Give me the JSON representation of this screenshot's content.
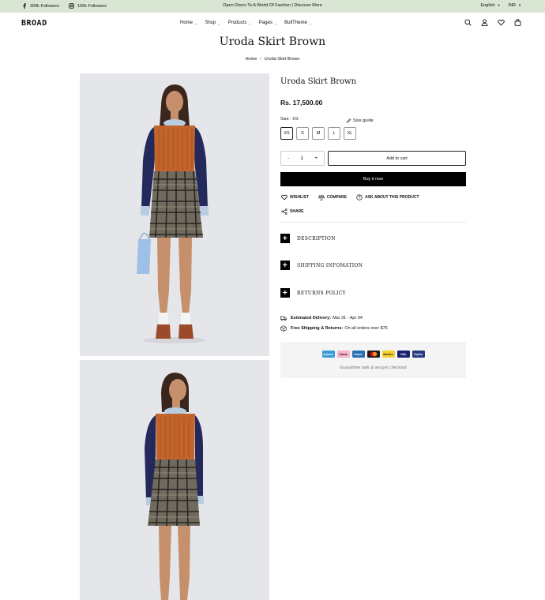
{
  "topbar": {
    "facebook_followers": "300k Followers",
    "instagram_followers": "100k Followers",
    "announcement": "Open Doors To A World Of Fashion | Discover More",
    "language": "English",
    "currency": "INR"
  },
  "header": {
    "logo": "BROAD",
    "nav": [
      "Home",
      "Shop",
      "Products",
      "Pages",
      "BullTheme"
    ],
    "icons": [
      "search-icon",
      "user-icon",
      "heart-icon",
      "bag-icon"
    ]
  },
  "page": {
    "title": "Uroda Skirt Brown",
    "breadcrumb": [
      "Home",
      "Uroda Skirt Brown"
    ]
  },
  "product": {
    "title": "Uroda Skirt Brown",
    "price": "Rs. 17,500.00",
    "size_label": "Size : XS",
    "size_guide": "Size guide",
    "sizes": [
      "XS",
      "S",
      "M",
      "L",
      "XL"
    ],
    "selected_size": "XS",
    "quantity": "1",
    "qty_minus": "-",
    "qty_plus": "+",
    "add_to_cart": "Add to cart",
    "buy_now": "Buy it now",
    "wishlist": "WISHLIST",
    "compare": "COMPARE",
    "ask": "ASK ABOUT THIS PRODUCT",
    "share": "SHARE"
  },
  "accordion": {
    "description": "DESCRIPTION",
    "shipping": "SHIPPING INFOMATION",
    "returns": "RETURNS POLICY"
  },
  "delivery": {
    "estimated_label": "Estimated Delivery:",
    "estimated_value": "Mar 31 - Apr 04",
    "free_label": "Free Shipping & Returns:",
    "free_value": "On all orders over $75"
  },
  "payment": {
    "methods": [
      "Amazon",
      "Klarna",
      "Diners",
      "Mastercard",
      "Maestro",
      "VISA",
      "PayPal"
    ],
    "guarantee": "Guarantee safe & secure checkout"
  },
  "colors": {
    "topbar_bg": "#d9e6d3",
    "button_dark": "#000000",
    "photo_bg": "#e5e6ea"
  }
}
